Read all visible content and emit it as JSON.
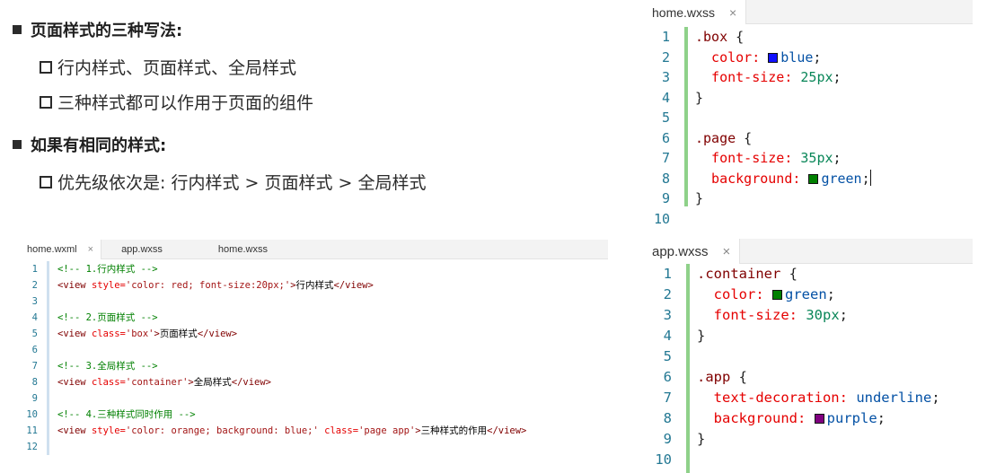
{
  "slide": {
    "heading1": "页面样式的三种写法:",
    "item1": "行内样式、页面样式、全局样式",
    "item2": "三种样式都可以作用于页面的组件",
    "heading2": "如果有相同的样式:",
    "item3": "优先级依次是: 行内样式 > 页面样式 > 全局样式"
  },
  "home_wxss": {
    "tab": "home.wxss",
    "close": "×",
    "lines": [
      {
        "n": "1",
        "tokens": [
          {
            "c": "sel",
            "t": ".box"
          },
          {
            "c": "pun",
            "t": " {"
          }
        ]
      },
      {
        "n": "2",
        "tokens": [
          {
            "c": "prop",
            "t": "  color: "
          },
          {
            "c": "swatch",
            "color": "#1010ff"
          },
          {
            "c": "val",
            "t": "blue"
          },
          {
            "c": "pun",
            "t": ";"
          }
        ]
      },
      {
        "n": "3",
        "tokens": [
          {
            "c": "prop",
            "t": "  font-size: "
          },
          {
            "c": "num",
            "t": "25px"
          },
          {
            "c": "pun",
            "t": ";"
          }
        ]
      },
      {
        "n": "4",
        "tokens": [
          {
            "c": "pun",
            "t": "}"
          }
        ]
      },
      {
        "n": "5",
        "tokens": []
      },
      {
        "n": "6",
        "tokens": [
          {
            "c": "sel",
            "t": ".page"
          },
          {
            "c": "pun",
            "t": " {"
          }
        ]
      },
      {
        "n": "7",
        "tokens": [
          {
            "c": "prop",
            "t": "  font-size: "
          },
          {
            "c": "num",
            "t": "35px"
          },
          {
            "c": "pun",
            "t": ";"
          }
        ]
      },
      {
        "n": "8",
        "tokens": [
          {
            "c": "prop",
            "t": "  background: "
          },
          {
            "c": "swatch",
            "color": "#008000"
          },
          {
            "c": "val",
            "t": "green"
          },
          {
            "c": "pun",
            "t": ";"
          },
          {
            "c": "cursor"
          }
        ]
      },
      {
        "n": "9",
        "tokens": [
          {
            "c": "pun",
            "t": "}"
          }
        ]
      },
      {
        "n": "10",
        "tokens": []
      }
    ]
  },
  "home_wxml": {
    "tabs": [
      {
        "label": "home.wxml",
        "close": "×"
      },
      {
        "label": "app.wxss"
      },
      {
        "label": "home.wxss"
      }
    ],
    "lines": [
      {
        "n": "1",
        "tokens": [
          {
            "c": "cmt",
            "t": "<!-- 1.行内样式 -->"
          }
        ]
      },
      {
        "n": "2",
        "tokens": [
          {
            "c": "tag",
            "t": "<view "
          },
          {
            "c": "attr",
            "t": "style="
          },
          {
            "c": "str",
            "t": "'color: red; font-size:20px;'"
          },
          {
            "c": "tag",
            "t": ">"
          },
          {
            "c": "txt",
            "t": "行内样式"
          },
          {
            "c": "tag",
            "t": "</view>"
          }
        ]
      },
      {
        "n": "3",
        "tokens": []
      },
      {
        "n": "4",
        "tokens": [
          {
            "c": "cmt",
            "t": "<!-- 2.页面样式 -->"
          }
        ]
      },
      {
        "n": "5",
        "tokens": [
          {
            "c": "tag",
            "t": "<view "
          },
          {
            "c": "attr",
            "t": "class="
          },
          {
            "c": "str",
            "t": "'box'"
          },
          {
            "c": "tag",
            "t": ">"
          },
          {
            "c": "txt",
            "t": "页面样式"
          },
          {
            "c": "tag",
            "t": "</view>"
          }
        ]
      },
      {
        "n": "6",
        "tokens": []
      },
      {
        "n": "7",
        "tokens": [
          {
            "c": "cmt",
            "t": "<!-- 3.全局样式 -->"
          }
        ]
      },
      {
        "n": "8",
        "tokens": [
          {
            "c": "tag",
            "t": "<view "
          },
          {
            "c": "attr",
            "t": "class="
          },
          {
            "c": "str",
            "t": "'container'"
          },
          {
            "c": "tag",
            "t": ">"
          },
          {
            "c": "txt",
            "t": "全局样式"
          },
          {
            "c": "tag",
            "t": "</view>"
          }
        ]
      },
      {
        "n": "9",
        "tokens": []
      },
      {
        "n": "10",
        "tokens": [
          {
            "c": "cmt",
            "t": "<!-- 4.三种样式同时作用 -->"
          }
        ]
      },
      {
        "n": "11",
        "tokens": [
          {
            "c": "tag",
            "t": "<view "
          },
          {
            "c": "attr",
            "t": "style="
          },
          {
            "c": "str",
            "t": "'color: orange; background: blue;'"
          },
          {
            "c": "attr",
            "t": " class="
          },
          {
            "c": "str",
            "t": "'page app'"
          },
          {
            "c": "tag",
            "t": ">"
          },
          {
            "c": "txt",
            "t": "三种样式的作用"
          },
          {
            "c": "tag",
            "t": "</view>"
          }
        ]
      },
      {
        "n": "12",
        "tokens": []
      }
    ]
  },
  "app_wxss": {
    "tab": "app.wxss",
    "close": "×",
    "lines": [
      {
        "n": "1",
        "tokens": [
          {
            "c": "sel",
            "t": ".container"
          },
          {
            "c": "pun",
            "t": " {"
          }
        ]
      },
      {
        "n": "2",
        "tokens": [
          {
            "c": "prop",
            "t": "  color: "
          },
          {
            "c": "swatch",
            "color": "#008000"
          },
          {
            "c": "val",
            "t": "green"
          },
          {
            "c": "pun",
            "t": ";"
          }
        ]
      },
      {
        "n": "3",
        "tokens": [
          {
            "c": "prop",
            "t": "  font-size: "
          },
          {
            "c": "num",
            "t": "30px"
          },
          {
            "c": "pun",
            "t": ";"
          }
        ]
      },
      {
        "n": "4",
        "tokens": [
          {
            "c": "pun",
            "t": "}"
          }
        ]
      },
      {
        "n": "5",
        "tokens": []
      },
      {
        "n": "6",
        "tokens": [
          {
            "c": "sel",
            "t": ".app"
          },
          {
            "c": "pun",
            "t": " {"
          }
        ]
      },
      {
        "n": "7",
        "tokens": [
          {
            "c": "prop",
            "t": "  text-decoration: "
          },
          {
            "c": "val",
            "t": "underline"
          },
          {
            "c": "pun",
            "t": ";"
          }
        ]
      },
      {
        "n": "8",
        "tokens": [
          {
            "c": "prop",
            "t": "  background: "
          },
          {
            "c": "swatch",
            "color": "#800080"
          },
          {
            "c": "val",
            "t": "purple"
          },
          {
            "c": "pun",
            "t": ";"
          }
        ]
      },
      {
        "n": "9",
        "tokens": [
          {
            "c": "pun",
            "t": "}"
          }
        ]
      },
      {
        "n": "10",
        "tokens": []
      }
    ]
  }
}
